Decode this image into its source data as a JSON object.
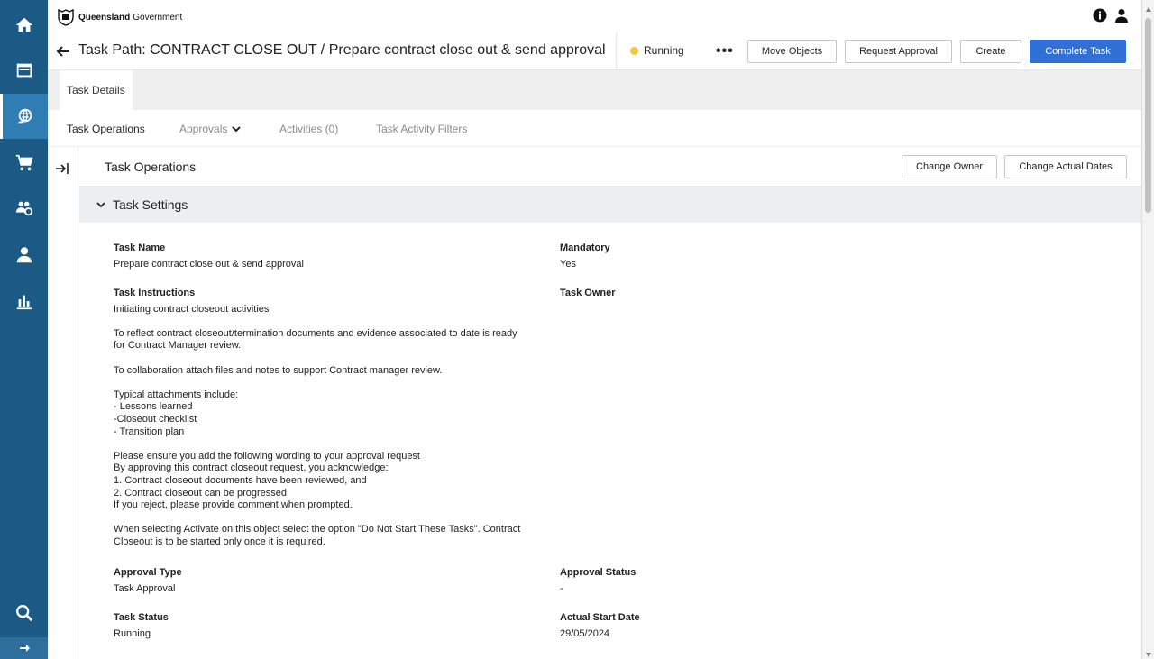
{
  "brand": {
    "name_bold": "Queensland",
    "name_rest": "Government"
  },
  "header": {
    "title": "Task Path: CONTRACT CLOSE OUT / Prepare contract close out & send approval",
    "status": "Running",
    "more": "•••",
    "buttons": {
      "move_objects": "Move Objects",
      "request_approval": "Request Approval",
      "create": "Create",
      "complete_task": "Complete Task"
    }
  },
  "tabs": {
    "task_details": "Task Details"
  },
  "subtabs": {
    "task_operations": "Task Operations",
    "approvals": "Approvals",
    "activities": "Activities (0)",
    "task_activity_filters": "Task Activity Filters"
  },
  "panel": {
    "title": "Task Operations",
    "change_owner": "Change Owner",
    "change_actual_dates": "Change Actual Dates"
  },
  "section": {
    "title": "Task Settings",
    "fields": {
      "task_name": {
        "label": "Task Name",
        "value": "Prepare contract close out & send approval"
      },
      "mandatory": {
        "label": "Mandatory",
        "value": "Yes"
      },
      "task_instructions": {
        "label": "Task Instructions",
        "value": "Initiating contract closeout activities\n\nTo reflect contract closeout/termination documents and evidence associated to date is ready\nfor Contract Manager review.\n\nTo collaboration attach files and notes to support Contract manager review.\n\nTypical attachments include:\n- Lessons learned\n-Closeout checklist\n- Transition plan\n\nPlease ensure you add the following wording to your approval request\nBy approving this contract closeout request, you acknowledge:\n1. Contract closeout documents have been reviewed, and\n2. Contract closeout can be progressed\nIf you reject, please provide comment when prompted.\n\nWhen selecting Activate on this object select the option \"Do Not Start These Tasks\". Contract\nCloseout is to be started only once it is required."
      },
      "task_owner": {
        "label": "Task Owner",
        "value": ""
      },
      "approval_type": {
        "label": "Approval Type",
        "value": "Task Approval"
      },
      "approval_status": {
        "label": "Approval Status",
        "value": "-"
      },
      "task_status": {
        "label": "Task Status",
        "value": "Running"
      },
      "actual_start_date": {
        "label": "Actual Start Date",
        "value": "29/05/2024"
      }
    }
  },
  "colors": {
    "rail": "#1a5a85",
    "rail_active": "#2f7db3",
    "primary": "#2f6fd6",
    "status_dot": "#f5c542"
  }
}
